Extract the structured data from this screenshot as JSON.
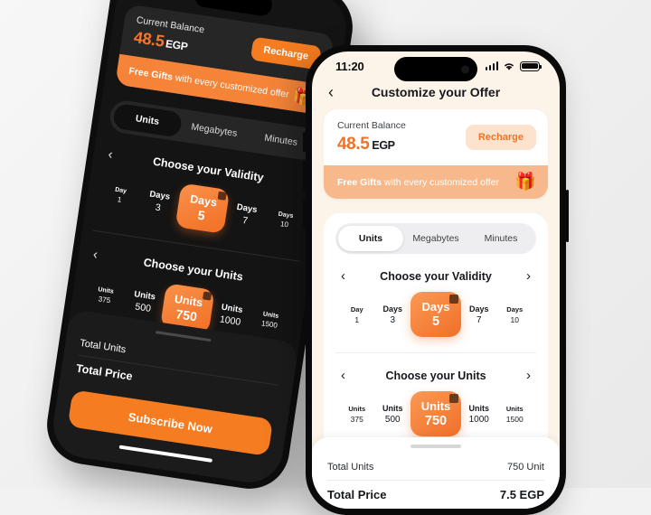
{
  "background_color": "#f2f2f2",
  "accent_color": "#f2712a",
  "phones": {
    "dark": {
      "theme": "dark",
      "balance": {
        "label": "Current Balance",
        "amount": "48.5",
        "currency": "EGP",
        "recharge_label": "Recharge"
      },
      "gift_banner": {
        "bold_text": "Free Gifts",
        "rest_text": " with every customized offer",
        "emoji": "🎁"
      },
      "tabs": [
        {
          "label": "Units",
          "active": true
        },
        {
          "label": "Megabytes",
          "active": false
        },
        {
          "label": "Minutes",
          "active": false
        }
      ],
      "validity": {
        "title": "Choose your Validity",
        "prev_icon": "‹",
        "next_icon": "›",
        "options": [
          {
            "unit": "Day",
            "value": "1",
            "selected": false
          },
          {
            "unit": "Days",
            "value": "3",
            "selected": false
          },
          {
            "unit": "Days",
            "value": "5",
            "selected": true,
            "badge": "🗓"
          },
          {
            "unit": "Days",
            "value": "7",
            "selected": false
          },
          {
            "unit": "Days",
            "value": "10",
            "selected": false
          }
        ]
      },
      "units": {
        "title": "Choose your Units",
        "prev_icon": "‹",
        "next_icon": "›",
        "options": [
          {
            "unit": "Units",
            "value": "375",
            "selected": false
          },
          {
            "unit": "Units",
            "value": "500",
            "selected": false
          },
          {
            "unit": "Units",
            "value": "750",
            "selected": true,
            "badge": "🔥"
          },
          {
            "unit": "Units",
            "value": "1000",
            "selected": false
          },
          {
            "unit": "Units",
            "value": "1500",
            "selected": false
          }
        ]
      },
      "summary": {
        "total_units_label": "Total Units",
        "total_units_value": "",
        "total_price_label": "Total Price",
        "total_price_value": "",
        "cta_label": "Subscribe Now"
      }
    },
    "light": {
      "theme": "light",
      "status_bar": {
        "time": "11:20",
        "signal_icon": "cellular-signal",
        "wifi_icon": "wifi",
        "battery_icon": "battery-full"
      },
      "nav": {
        "back_icon": "‹",
        "title": "Customize your Offer"
      },
      "balance": {
        "label": "Current Balance",
        "amount": "48.5",
        "currency": "EGP",
        "recharge_label": "Recharge"
      },
      "gift_banner": {
        "bold_text": "Free Gifts",
        "rest_text": " with every customized offer",
        "emoji": "🎁"
      },
      "tabs": [
        {
          "label": "Units",
          "active": true
        },
        {
          "label": "Megabytes",
          "active": false
        },
        {
          "label": "Minutes",
          "active": false
        }
      ],
      "validity": {
        "title": "Choose your Validity",
        "prev_icon": "‹",
        "next_icon": "›",
        "options": [
          {
            "unit": "Day",
            "value": "1",
            "selected": false
          },
          {
            "unit": "Days",
            "value": "3",
            "selected": false
          },
          {
            "unit": "Days",
            "value": "5",
            "selected": true,
            "badge": "🗓"
          },
          {
            "unit": "Days",
            "value": "7",
            "selected": false
          },
          {
            "unit": "Days",
            "value": "10",
            "selected": false
          }
        ]
      },
      "units": {
        "title": "Choose your Units",
        "prev_icon": "‹",
        "next_icon": "›",
        "options": [
          {
            "unit": "Units",
            "value": "375",
            "selected": false
          },
          {
            "unit": "Units",
            "value": "500",
            "selected": false
          },
          {
            "unit": "Units",
            "value": "750",
            "selected": true,
            "badge": "🔥"
          },
          {
            "unit": "Units",
            "value": "1000",
            "selected": false
          },
          {
            "unit": "Units",
            "value": "1500",
            "selected": false
          }
        ]
      },
      "summary": {
        "total_units_label": "Total Units",
        "total_units_value": "750 Unit",
        "total_price_label": "Total Price",
        "total_price_value": "7.5 EGP"
      }
    }
  }
}
